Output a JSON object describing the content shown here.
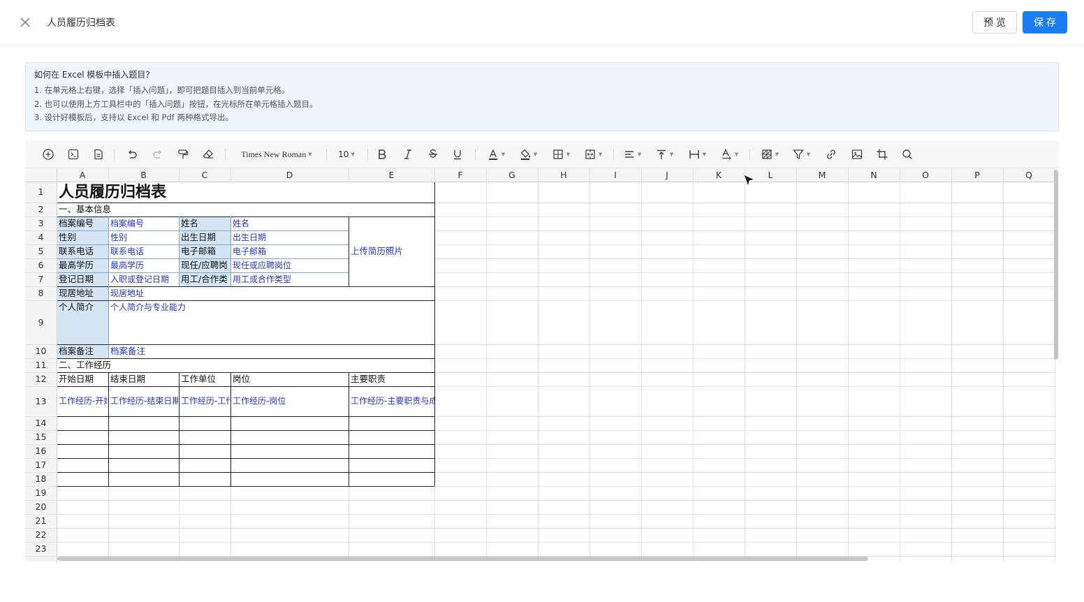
{
  "header": {
    "title": "人员履历归档表",
    "preview_label": "预览",
    "save_label": "保存"
  },
  "help": {
    "title": "如何在 Excel 模板中插入题目?",
    "lines": [
      "1. 在单元格上右键，选择「插入问题」，即可把题目插入到当前单元格。",
      "2. 也可以使用上方工具栏中的「插入问题」按钮，在光标所在单元格插入题目。",
      "3. 设计好模板后，支持以 Excel 和 Pdf 两种格式导出。"
    ]
  },
  "toolbar": {
    "font_family": "Times New Roman",
    "font_size": "10",
    "icons": [
      "insert-question-icon",
      "formula-icon",
      "page-icon",
      "undo-icon",
      "redo-icon",
      "format-painter-icon",
      "clear-format-icon",
      "bold-icon",
      "italic-icon",
      "strikethrough-icon",
      "underline-icon",
      "text-color-icon",
      "fill-color-icon",
      "border-icon",
      "merge-cells-icon",
      "horizontal-align-icon",
      "vertical-align-icon",
      "text-wrap-icon",
      "text-rotate-icon",
      "conditional-format-icon",
      "filter-icon",
      "link-icon",
      "image-icon",
      "crop-icon",
      "search-icon"
    ]
  },
  "sheet": {
    "columns": [
      "A",
      "B",
      "C",
      "D",
      "E",
      "F",
      "G",
      "H",
      "I",
      "J",
      "K",
      "L",
      "M",
      "N",
      "O",
      "P",
      "Q"
    ],
    "rows": [
      "1",
      "2",
      "3",
      "4",
      "5",
      "6",
      "7",
      "8",
      "9",
      "10",
      "11",
      "12",
      "13",
      "14",
      "15",
      "16",
      "17",
      "18",
      "19",
      "20",
      "21",
      "22",
      "23"
    ],
    "title": "人员履历归档表",
    "section1": "一、基本信息",
    "section2": "二、工作经历",
    "labels": {
      "archive_no": "档案编号",
      "name": "姓名",
      "gender": "性别",
      "birth": "出生日期",
      "phone": "联系电话",
      "email": "电子邮箱",
      "education": "最高学历",
      "position": "现任/应聘岗",
      "reg_date": "登记日期",
      "work_type": "用工/合作类",
      "address": "现居地址",
      "intro": "个人简介",
      "remark": "档案备注"
    },
    "fields": {
      "archive_no": "档案编号",
      "name": "姓名",
      "gender": "性别",
      "birth": "出生日期",
      "phone": "联系电话",
      "email": "电子邮箱",
      "education": "最高学历",
      "position": "现任或应聘岗位",
      "reg_date": "入职或登记日期",
      "work_type": "用工或合作类型",
      "address": "现居地址",
      "intro": "个人简介与专业能力",
      "remark": "档案备注",
      "photo": "上传简历照片"
    },
    "work_headers": [
      "开始日期",
      "结束日期",
      "工作单位",
      "岗位",
      "主要职责"
    ],
    "work_fields": [
      "工作经历-开始日期",
      "工作经历-结束日期",
      "工作经历-工作单位",
      "工作经历-岗位",
      "工作经历-主要职责与成果"
    ]
  }
}
